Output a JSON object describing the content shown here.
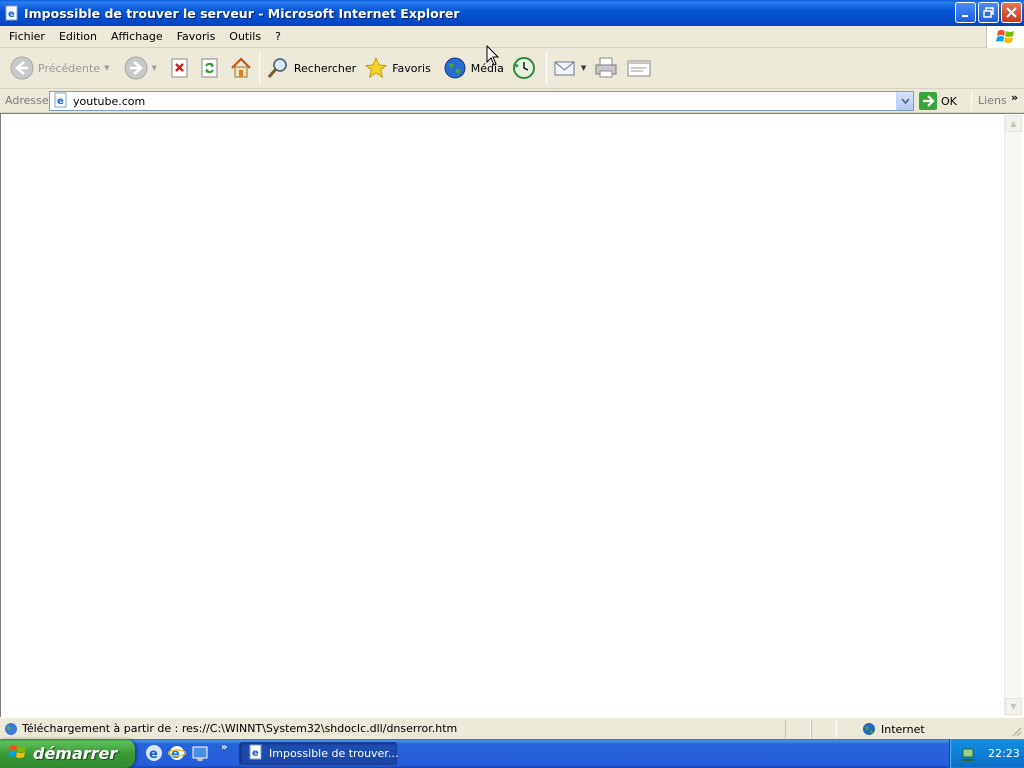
{
  "window": {
    "title": "Impossible de trouver le serveur - Microsoft Internet Explorer",
    "buttons": [
      "minimize",
      "restore",
      "close"
    ]
  },
  "menu": {
    "items": [
      "Fichier",
      "Edition",
      "Affichage",
      "Favoris",
      "Outils",
      "?"
    ]
  },
  "toolbar": {
    "back_label": "Précédente",
    "search_label": "Rechercher",
    "favorites_label": "Favoris",
    "media_label": "Média"
  },
  "address": {
    "label": "Adresse",
    "url": "youtube.com",
    "go_label": "OK",
    "links_label": "Liens"
  },
  "status": {
    "text": "Téléchargement à partir de : res://C:\\WINNT\\System32\\shdoclc.dll/dnserror.htm",
    "zone": "Internet"
  },
  "taskbar": {
    "start_label": "démarrer",
    "task_label": "Impossible de trouver...",
    "clock": "22:23"
  },
  "colors": {
    "titlebar": "#0a5fd8",
    "taskbar": "#245edb",
    "start_button": "#3a9b36",
    "tray": "#0f7fd6",
    "chrome": "#ece9d8"
  }
}
